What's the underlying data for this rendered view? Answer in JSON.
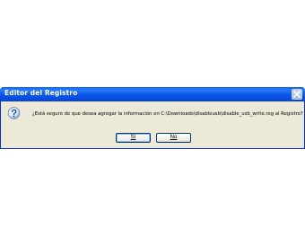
{
  "window": {
    "title": "Editor del Registro",
    "close_icon": "close-icon"
  },
  "message": {
    "icon": "question-icon",
    "text": "¿Está seguro de que desea agregar la información en C:\\Downloads\\disableusb\\disable_usb_write.reg al Registro?"
  },
  "buttons": {
    "yes_label": "Sí",
    "no_label": "No"
  },
  "colors": {
    "titlebar": "#0a55e8",
    "dialog_background": "#ece9d8",
    "page_background": "#ffffff"
  }
}
